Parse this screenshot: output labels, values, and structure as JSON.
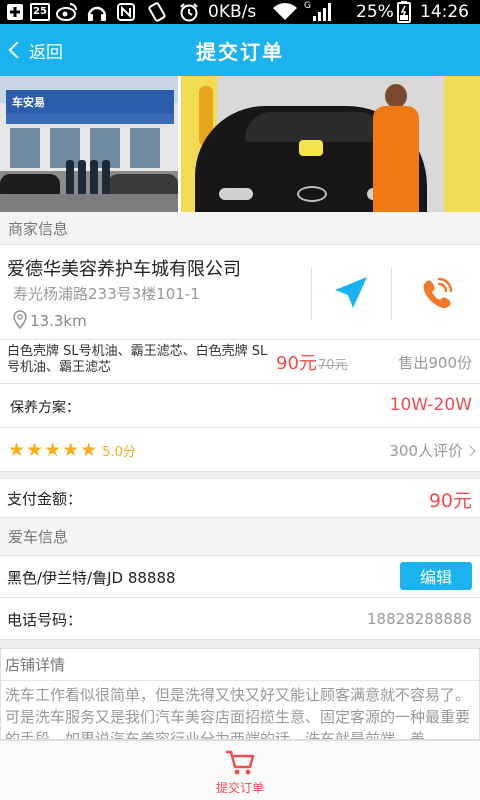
{
  "status_bar": {
    "notif_count": "25",
    "speed": "0KB/s",
    "signal_type": "G",
    "battery": "25%",
    "time": "14:26"
  },
  "title_bar": {
    "back_label": "返回",
    "title": "提交订单"
  },
  "banner": {
    "shop_sign": "车安易"
  },
  "merchant_section": {
    "header": "商家信息",
    "name": "爱德华美容养护车城有限公司",
    "address": "寿光杨浦路233号3楼101-1",
    "distance": "13.3km"
  },
  "service": {
    "description": "白色壳牌  SL号机油、霸王滤芯、白色壳牌  SL号机油、霸王滤芯",
    "price": "90元",
    "original_price": "70元",
    "sold": "售出900份"
  },
  "plan": {
    "label": "保养方案：",
    "value": "10W-20W"
  },
  "rating": {
    "stars": 5,
    "score": "5.0分",
    "reviews": "300人评价"
  },
  "payment": {
    "label": "支付金额：",
    "amount": "90元"
  },
  "car_section": {
    "header": "爱车信息",
    "car_info": "黑色/伊兰特/鲁JD 88888",
    "edit_label": "编辑",
    "phone_label": "电话号码：",
    "phone_value": "18828288888"
  },
  "shop_detail": {
    "header": "店铺详情",
    "text": "洗车工作看似很简单，但是洗得又快又好又能让顾客满意就不容易了。可是洗车服务又是我们汽车美容店面招揽生意、固定客源的一种最重要的手段，如果说汽车美容行业分为两端的话，洗车就是前端，美"
  },
  "tab_bar": {
    "submit_label": "提交订单"
  },
  "colors": {
    "accent": "#1ab3f0",
    "price_red": "#f24c4c",
    "star": "#f6ad1c",
    "call_orange": "#f07a2a"
  }
}
